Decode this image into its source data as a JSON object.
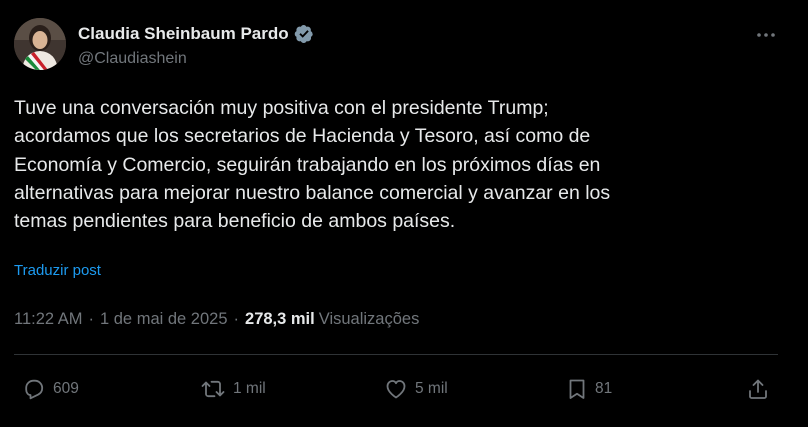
{
  "author": {
    "display_name": "Claudia Sheinbaum Pardo",
    "handle": "@Claudiashein",
    "verified": true
  },
  "post": {
    "text": "Tuve una conversación muy positiva con el presidente Trump;\nacordamos que los secretarios de Hacienda y Tesoro, así como de\nEconomía y Comercio, seguirán trabajando en los próximos días en\nalternativas para mejorar nuestro balance comercial y avanzar en los\ntemas pendientes para beneficio de ambos países.",
    "translate_label": "Traduzir post"
  },
  "meta": {
    "time": "11:22 AM",
    "separator": "·",
    "date": "1 de mai de 2025",
    "views_count": "278,3 mil",
    "views_label": "Visualizações"
  },
  "actions": {
    "replies": "609",
    "reposts": "1 mil",
    "likes": "5 mil",
    "bookmarks": "81"
  },
  "icons": {
    "more": "more-horizontal-icon",
    "verified": "verified-badge-icon",
    "reply": "reply-icon",
    "repost": "repost-icon",
    "like": "heart-icon",
    "bookmark": "bookmark-icon",
    "share": "share-icon"
  },
  "colors": {
    "background": "#000000",
    "text_primary": "#e7e9ea",
    "text_secondary": "#71767b",
    "accent": "#1d9bf0",
    "divider": "#2f3336"
  }
}
